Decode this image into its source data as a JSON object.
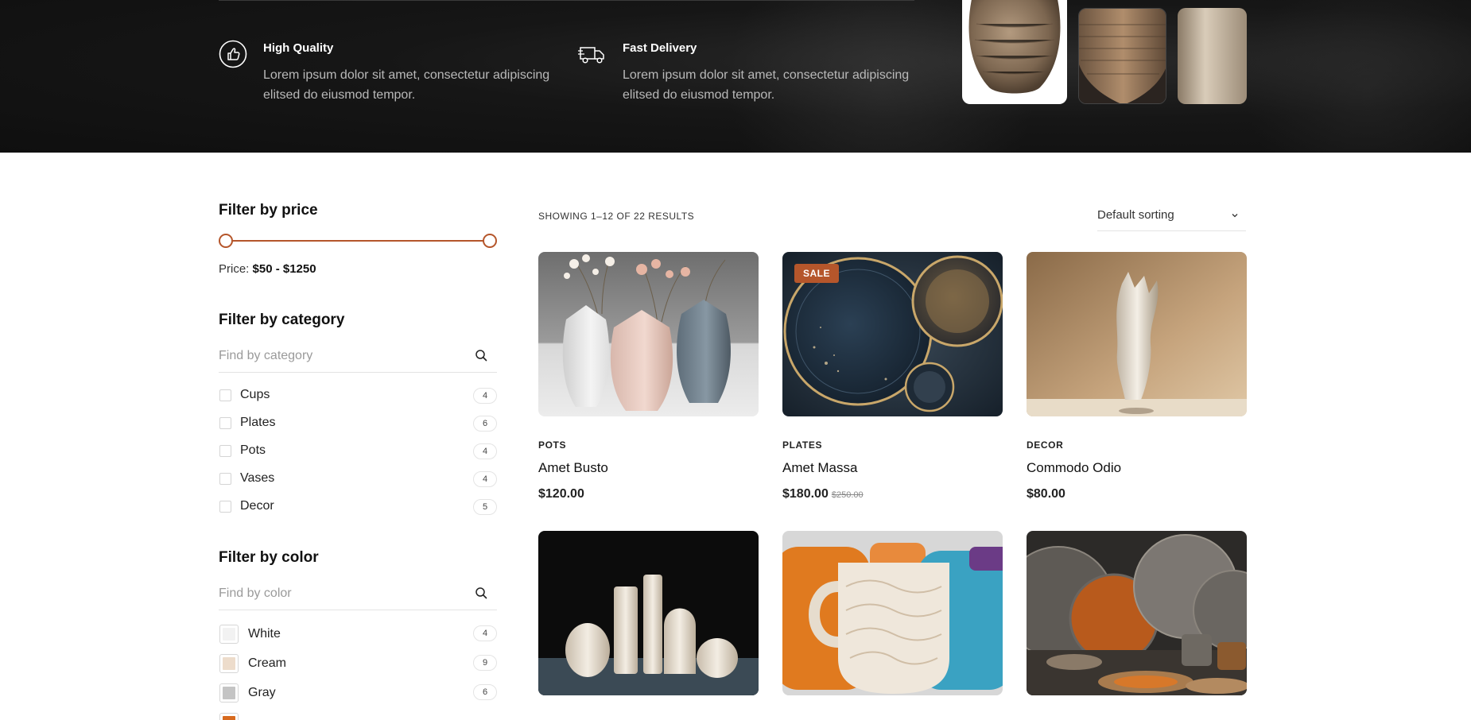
{
  "hero": {
    "features": [
      {
        "title": "High Quality",
        "text": "Lorem ipsum dolor sit amet, consectetur adipiscing elitsed do eiusmod tempor.",
        "icon": "thumbs-up-icon"
      },
      {
        "title": "Fast Delivery",
        "text": "Lorem ipsum dolor sit amet, consectetur adipiscing elitsed do eiusmod tempor.",
        "icon": "delivery-truck-icon"
      }
    ]
  },
  "sidebar": {
    "price": {
      "title": "Filter by price",
      "label": "Price:",
      "range": "$50 - $1250",
      "min_fraction": 0,
      "max_fraction": 1,
      "accent": "#b5562b"
    },
    "category": {
      "title": "Filter by category",
      "placeholder": "Find by category",
      "items": [
        {
          "label": "Cups",
          "count": "4"
        },
        {
          "label": "Plates",
          "count": "6"
        },
        {
          "label": "Pots",
          "count": "4"
        },
        {
          "label": "Vases",
          "count": "4"
        },
        {
          "label": "Decor",
          "count": "5"
        }
      ]
    },
    "color": {
      "title": "Filter by color",
      "placeholder": "Find by color",
      "items": [
        {
          "label": "White",
          "count": "4",
          "swatch": "#f2f2f2"
        },
        {
          "label": "Cream",
          "count": "9",
          "swatch": "#eddccb"
        },
        {
          "label": "Gray",
          "count": "6",
          "swatch": "#c4c4c4"
        },
        {
          "label": "",
          "count": "",
          "swatch": "#d76a1e"
        }
      ]
    }
  },
  "toolbar": {
    "result_count": "SHOWING 1–12 OF 22 RESULTS",
    "sorting": "Default sorting"
  },
  "products": [
    {
      "category": "POTS",
      "name": "Amet Busto",
      "price": "$120.00",
      "old_price": "",
      "badge": ""
    },
    {
      "category": "PLATES",
      "name": "Amet Massa",
      "price": "$180.00",
      "old_price": "$250.00",
      "badge": "SALE"
    },
    {
      "category": "DECOR",
      "name": "Commodo Odio",
      "price": "$80.00",
      "old_price": "",
      "badge": ""
    },
    {
      "category": "",
      "name": "",
      "price": "",
      "old_price": "",
      "badge": ""
    },
    {
      "category": "",
      "name": "",
      "price": "",
      "old_price": "",
      "badge": ""
    },
    {
      "category": "",
      "name": "",
      "price": "",
      "old_price": "",
      "badge": ""
    }
  ],
  "colors": {
    "accent": "#b5562b",
    "hero_bg": "#141414"
  }
}
